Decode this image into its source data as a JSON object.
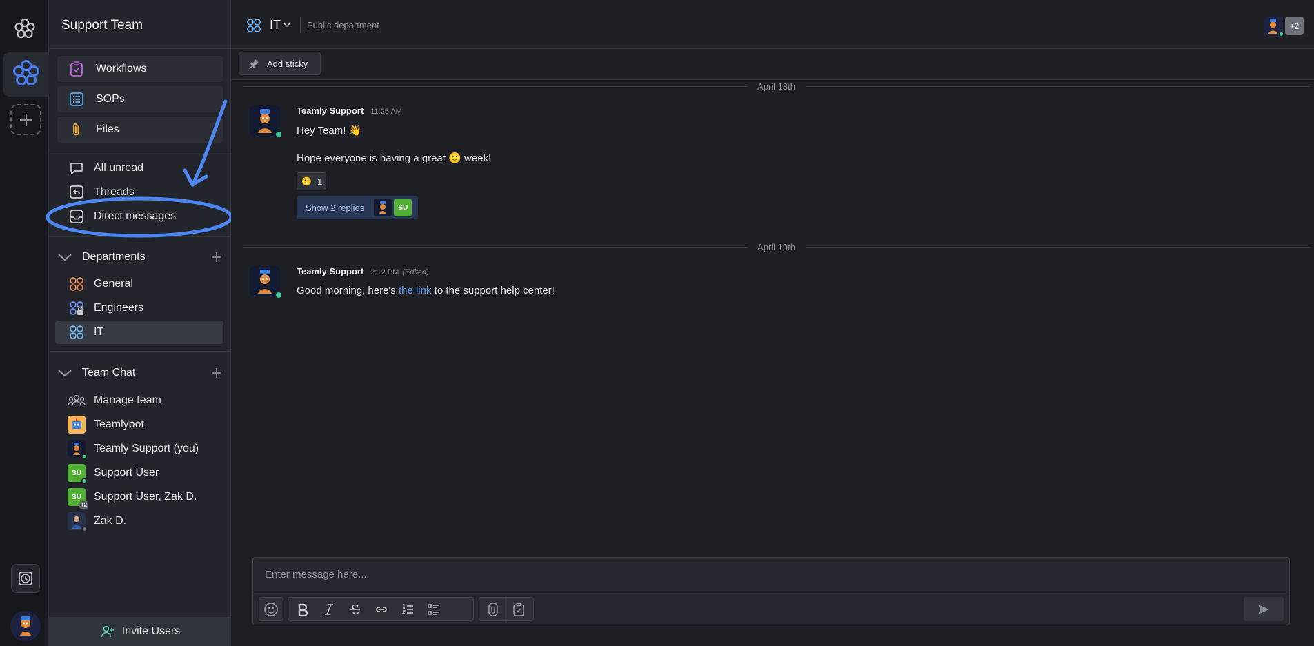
{
  "colors": {
    "accent": "#4a7cf2",
    "annotation": "#4d86f0",
    "online": "#3ec59a",
    "user_green": "#4fae33",
    "link": "#5b9cf6"
  },
  "rail": {
    "logo_icon": "flower-logo-icon",
    "active_workspace_icon": "flower-logo-icon",
    "add_workspace_icon": "plus-icon",
    "history_icon": "clock-icon"
  },
  "sidebar": {
    "team_name": "Support Team",
    "tools": [
      {
        "label": "Workflows",
        "icon": "clipboard-check-icon"
      },
      {
        "label": "SOPs",
        "icon": "list-icon"
      },
      {
        "label": "Files",
        "icon": "paperclip-icon"
      }
    ],
    "nav": [
      {
        "label": "All unread",
        "icon": "chat-bubble-icon"
      },
      {
        "label": "Threads",
        "icon": "thread-reply-icon"
      },
      {
        "label": "Direct messages",
        "icon": "inbox-icon"
      }
    ],
    "departments": {
      "title": "Departments",
      "items": [
        {
          "label": "General",
          "icon": "four-circles-icon"
        },
        {
          "label": "Engineers",
          "icon": "four-circles-lock-icon"
        },
        {
          "label": "IT",
          "icon": "four-circles-icon",
          "active": true
        }
      ]
    },
    "team_chat": {
      "title": "Team Chat",
      "items": [
        {
          "label": "Manage team",
          "icon": "people-icon"
        },
        {
          "label": "Teamlybot"
        },
        {
          "label": "Teamly Support (you)"
        },
        {
          "label": "Support User",
          "initials": "SU"
        },
        {
          "label": "Support User, Zak D.",
          "initials": "SU",
          "badge": "+2"
        },
        {
          "label": "Zak D."
        }
      ]
    },
    "invite_label": "Invite Users"
  },
  "channel": {
    "name": "IT",
    "type": "Public department",
    "members_more": "+2"
  },
  "sticky": {
    "label": "Add sticky"
  },
  "messages": [
    {
      "date": "April 18th",
      "author": "Teamly Support",
      "time": "11:25 AM",
      "line1": "Hey Team! 👋",
      "line2_before": "Hope everyone is having a great ",
      "line2_emoji": "🙂",
      "line2_after": " week!",
      "reaction_emoji": "🙂",
      "reaction_count": "1",
      "replies_label": "Show 2 replies",
      "reply_initials": "SU"
    },
    {
      "date": "April 19th",
      "author": "Teamly Support",
      "time": "2:12 PM",
      "edited": "(Edited)",
      "text_before": "Good morning, here's ",
      "link_text": "the link",
      "text_after": " to the support help center!"
    }
  ],
  "composer": {
    "placeholder": "Enter message here..."
  }
}
